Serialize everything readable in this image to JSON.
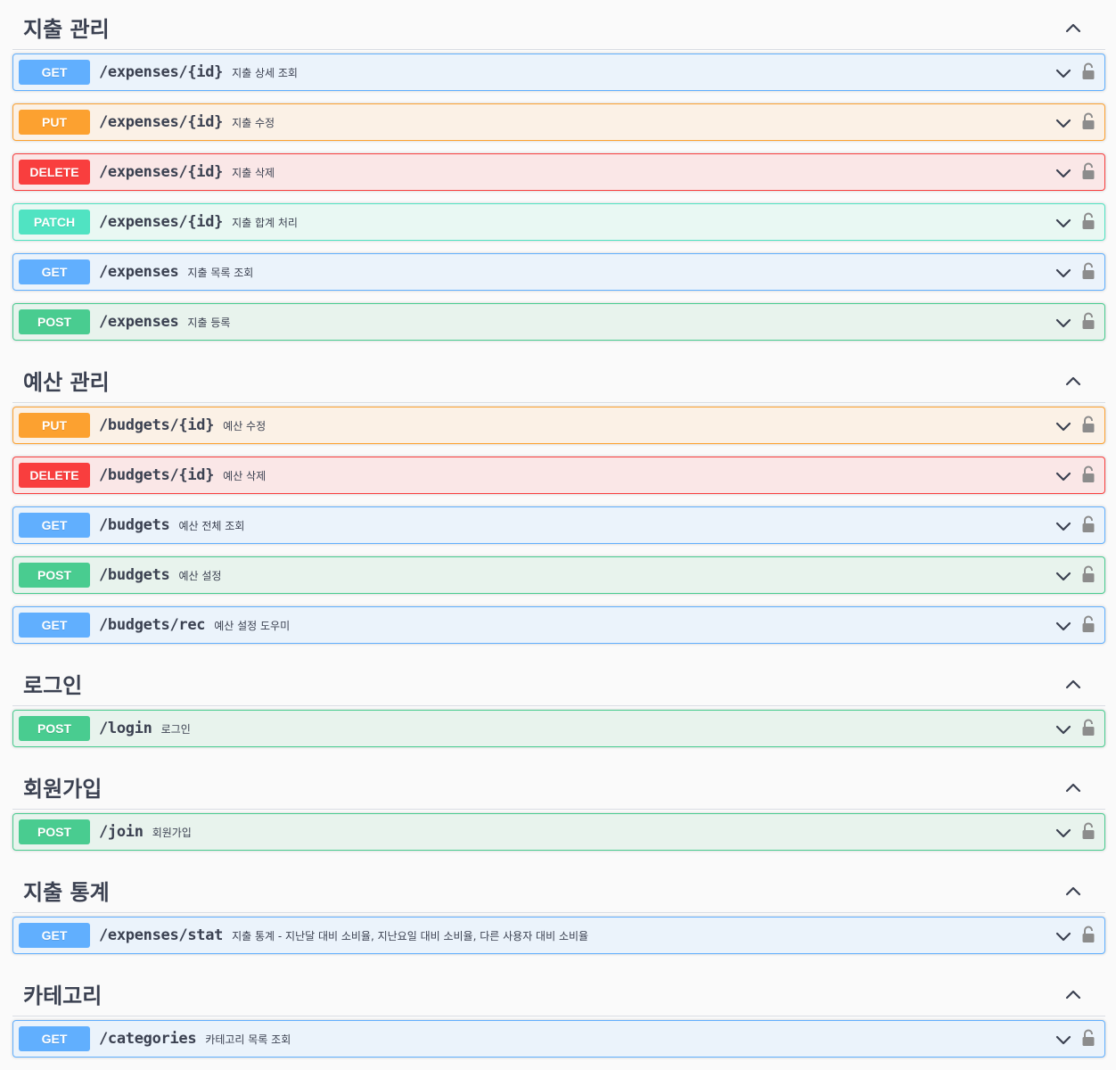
{
  "sections": [
    {
      "title": "지출 관리",
      "ops": [
        {
          "method": "GET",
          "path": "/expenses/{id}",
          "summary": "지출 상세 조회"
        },
        {
          "method": "PUT",
          "path": "/expenses/{id}",
          "summary": "지출 수정"
        },
        {
          "method": "DELETE",
          "path": "/expenses/{id}",
          "summary": "지출 삭제"
        },
        {
          "method": "PATCH",
          "path": "/expenses/{id}",
          "summary": "지출 합계 처리"
        },
        {
          "method": "GET",
          "path": "/expenses",
          "summary": "지출 목록 조회"
        },
        {
          "method": "POST",
          "path": "/expenses",
          "summary": "지출 등록"
        }
      ]
    },
    {
      "title": "예산 관리",
      "ops": [
        {
          "method": "PUT",
          "path": "/budgets/{id}",
          "summary": "예산 수정"
        },
        {
          "method": "DELETE",
          "path": "/budgets/{id}",
          "summary": "예산 삭제"
        },
        {
          "method": "GET",
          "path": "/budgets",
          "summary": "예산 전체 조회"
        },
        {
          "method": "POST",
          "path": "/budgets",
          "summary": "예산 설정"
        },
        {
          "method": "GET",
          "path": "/budgets/rec",
          "summary": "예산 설정 도우미"
        }
      ]
    },
    {
      "title": "로그인",
      "ops": [
        {
          "method": "POST",
          "path": "/login",
          "summary": "로그인"
        }
      ]
    },
    {
      "title": "회원가입",
      "ops": [
        {
          "method": "POST",
          "path": "/join",
          "summary": "회원가입"
        }
      ]
    },
    {
      "title": "지출 통계",
      "ops": [
        {
          "method": "GET",
          "path": "/expenses/stat",
          "summary": "지출 통계 - 지난달 대비 소비율, 지난요일 대비 소비율, 다른 사용자 대비 소비율"
        }
      ]
    },
    {
      "title": "카테고리",
      "ops": [
        {
          "method": "GET",
          "path": "/categories",
          "summary": "카테고리 목록 조회"
        }
      ]
    }
  ],
  "icons": {
    "section_toggle": "chevron-up-icon",
    "op_toggle": "chevron-down-icon",
    "auth": "unlocked-padlock-icon"
  },
  "colors": {
    "GET": "#61affe",
    "PUT": "#fca130",
    "DELETE": "#f93e3e",
    "PATCH": "#50e3c2",
    "POST": "#49cc90"
  }
}
